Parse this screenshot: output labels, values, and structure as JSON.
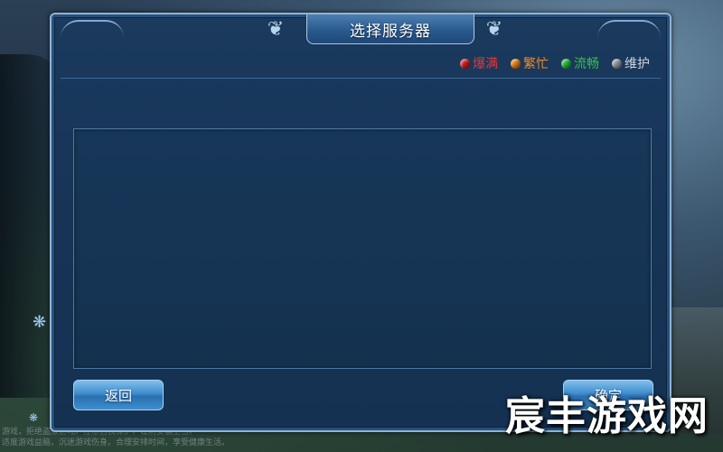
{
  "dialog": {
    "title": "选择服务器",
    "confirm_label": "确定",
    "back_label": "返回"
  },
  "legend": [
    {
      "label": "爆满",
      "color": "#e03a3a",
      "dot": "#d01818"
    },
    {
      "label": "繁忙",
      "color": "#f08a2a",
      "dot": "#e07810"
    },
    {
      "label": "流畅",
      "color": "#34c24a",
      "dot": "#22b030"
    },
    {
      "label": "维护",
      "color": "#d0d6dc",
      "dot": "#8a8f94"
    }
  ],
  "watermark": "宸丰游戏网",
  "footer": {
    "line1": "游戏，拒绝盗版游戏。注意自我保护，谨防受骗上当。",
    "line2": "适度游戏益脑，沉迷游戏伤身。合理安排时间，享受健康生活。"
  }
}
